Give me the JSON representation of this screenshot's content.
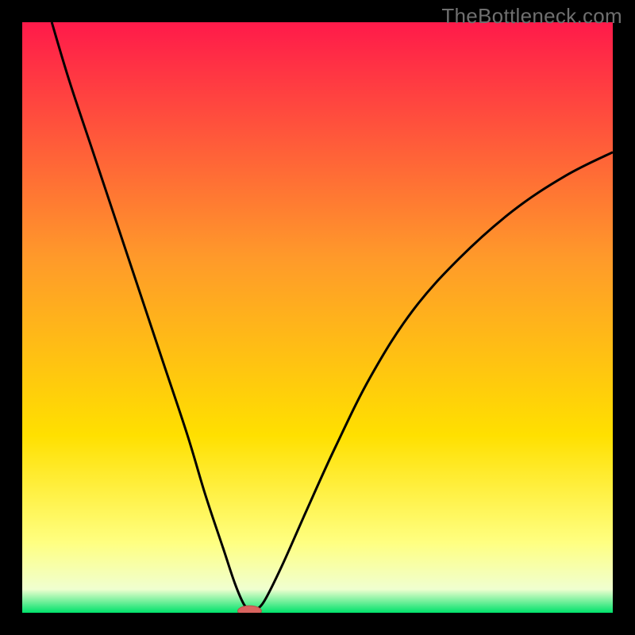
{
  "watermark": "TheBottleneck.com",
  "colors": {
    "frame": "#000000",
    "gradient_top": "#ff1a4a",
    "gradient_mid1": "#ff7a2a",
    "gradient_mid2": "#ffd000",
    "gradient_mid3": "#ffff66",
    "gradient_mid4": "#f5ffc0",
    "gradient_bottom": "#00e26a",
    "curve": "#000000",
    "marker_fill": "#d9645f",
    "marker_stroke": "#b94f49"
  },
  "chart_data": {
    "type": "line",
    "title": "",
    "xlabel": "",
    "ylabel": "",
    "xlim": [
      0,
      100
    ],
    "ylim": [
      0,
      100
    ],
    "y_orientation": "0_at_bottom_increasing_upward",
    "description": "V-shaped bottleneck curve. Two monotone branches meeting near x≈38 at y≈0. Left branch enters from top-left (x≈5, y≈100) descending steeply; right branch rises from the minimum and exits near top-right (x≈100, y≈78). Background vertical gradient encodes y: red(top)→orange→yellow→pale→green(bottom).",
    "series": [
      {
        "name": "left-branch",
        "x": [
          5,
          8,
          12,
          16,
          20,
          24,
          28,
          31,
          34,
          36,
          37.5,
          38.5
        ],
        "y": [
          100,
          90,
          78,
          66,
          54,
          42,
          30,
          20,
          11,
          5,
          1.5,
          0.5
        ]
      },
      {
        "name": "right-branch",
        "x": [
          39.5,
          41,
          44,
          48,
          53,
          59,
          66,
          74,
          83,
          92,
          100
        ],
        "y": [
          0.5,
          2,
          8,
          17,
          28,
          40,
          51,
          60,
          68,
          74,
          78
        ]
      }
    ],
    "marker": {
      "x": 38.5,
      "y": 0.3,
      "rx": 2.0,
      "ry": 0.9
    },
    "background_gradient_stops": [
      {
        "y": 100,
        "color": "#ff1a4a"
      },
      {
        "y": 60,
        "color": "#ff9a2a"
      },
      {
        "y": 30,
        "color": "#ffe000"
      },
      {
        "y": 12,
        "color": "#ffff80"
      },
      {
        "y": 4,
        "color": "#f0ffd0"
      },
      {
        "y": 0,
        "color": "#00e26a"
      }
    ]
  }
}
